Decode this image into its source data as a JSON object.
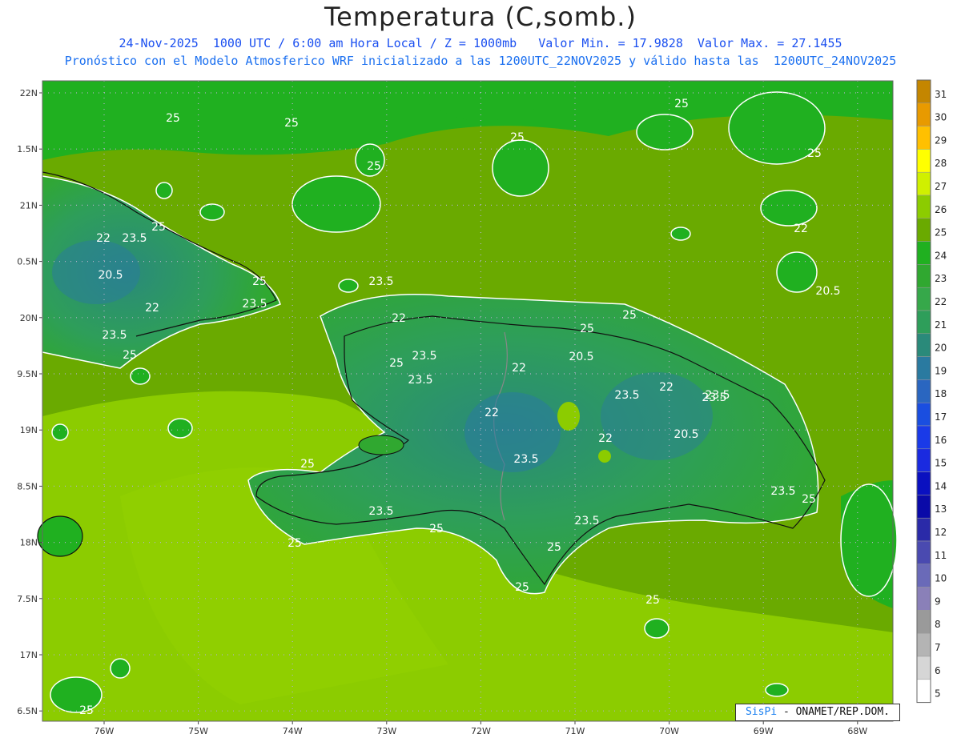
{
  "title": "Temperatura (C,somb.)",
  "subtitle1": "24-Nov-2025  1000 UTC / 6:00 am Hora Local / Z = 1000mb   Valor Min. = 17.9828  Valor Max. = 27.1455",
  "subtitle2": "Pronóstico con el Modelo Atmosferico WRF inicializado a las 1200UTC_22NOV2025 y válido hasta las  1200UTC_24NOV2025",
  "credit": {
    "brand": "SisPi",
    "text": "- ONAMET/REP.DOM."
  },
  "axes": {
    "lat_labels": [
      "22N",
      "1.5N",
      "21N",
      "0.5N",
      "20N",
      "9.5N",
      "19N",
      "8.5N",
      "18N",
      "7.5N",
      "17N",
      "6.5N"
    ],
    "lon_labels": [
      "76W",
      "75W",
      "74W",
      "73W",
      "72W",
      "71W",
      "70W",
      "69W",
      "68W"
    ]
  },
  "colorbar": {
    "levels": [
      "31",
      "30",
      "29",
      "28",
      "27",
      "26",
      "25",
      "24",
      "23",
      "22",
      "21",
      "20",
      "19",
      "18",
      "17",
      "16",
      "15",
      "14",
      "13",
      "12",
      "11",
      "10",
      "9",
      "8",
      "7",
      "6",
      "5"
    ],
    "colors": [
      "#c48600",
      "#e89a00",
      "#ffc000",
      "#ffff00",
      "#d0f000",
      "#8ccc00",
      "#6aaa00",
      "#20b020",
      "#30a830",
      "#36a84a",
      "#2e9e5a",
      "#2a8a7a",
      "#2a7aa0",
      "#2a66c0",
      "#1a4ee0",
      "#1a3ae8",
      "#1a2ae0",
      "#0a10c0",
      "#0a0aa8",
      "#2a2aa8",
      "#4a4ab0",
      "#6a6ab8",
      "#8a80b8",
      "#9a9a9a",
      "#b4b4b4",
      "#d6d6d6",
      "#ffffff"
    ]
  },
  "contour_labels": [
    "25",
    "25",
    "25",
    "25",
    "25",
    "25",
    "22",
    "23.5",
    "20.5",
    "22",
    "23.5",
    "25",
    "23.5",
    "25",
    "25",
    "23.5",
    "22",
    "20.5",
    "22",
    "23.5",
    "22",
    "20.5",
    "23.5",
    "22",
    "23.5",
    "25",
    "25",
    "22",
    "20.5",
    "22",
    "23.5",
    "25",
    "25",
    "23.5",
    "25",
    "25",
    "23.5",
    "23.5",
    "25",
    "25",
    "25",
    "23.5",
    "25",
    "23.5",
    "25"
  ]
}
